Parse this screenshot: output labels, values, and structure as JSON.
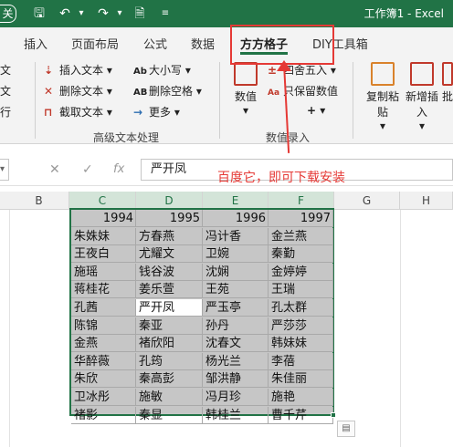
{
  "titlebar": {
    "left_chip": "关",
    "title": "工作簿1 - Excel"
  },
  "tabs": [
    "插入",
    "页面布局",
    "公式",
    "数据",
    "方方格子",
    "DIY工具箱"
  ],
  "active_tab": "方方格子",
  "ribbon": {
    "left_col": [
      "文",
      "文",
      "行"
    ],
    "text_group": {
      "items": [
        "插入文本",
        "删除文本",
        "截取文本",
        "大小写",
        "删除空格",
        "更多"
      ],
      "label": "高级文本处理"
    },
    "numeric_group": {
      "big_button": "数值",
      "items": [
        "四舍五入",
        "只保留数值"
      ],
      "plus": "+",
      "label": "数值录入"
    },
    "right_buttons": [
      "复制粘贴",
      "新增插入",
      "批"
    ]
  },
  "callout": {
    "text": "百度它，即可下载安装"
  },
  "formula_bar": {
    "fx": "fx",
    "value": "严开凤"
  },
  "columns": [
    "B",
    "C",
    "D",
    "E",
    "F",
    "G",
    "H"
  ],
  "table": {
    "headers": [
      "1994",
      "1995",
      "1996",
      "1997"
    ],
    "rows": [
      [
        "朱姝妹",
        "方春燕",
        "冯计香",
        "金兰燕"
      ],
      [
        "王夜白",
        "尤耀文",
        "卫婉",
        "秦勤"
      ],
      [
        "施瑶",
        "钱谷波",
        "沈娴",
        "金婷婷"
      ],
      [
        "蒋桂花",
        "姜乐萱",
        "王苑",
        "王瑞"
      ],
      [
        "孔茜",
        "严开凤",
        "严玉亭",
        "孔太群"
      ],
      [
        "陈锦",
        "秦亚",
        "孙丹",
        "严莎莎"
      ],
      [
        "金燕",
        "褚欣阳",
        "沈春文",
        "韩妹妹"
      ],
      [
        "华醉薇",
        "孔筠",
        "杨光兰",
        "李蓓"
      ],
      [
        "朱欣",
        "秦高彭",
        "邹洪静",
        "朱佳丽"
      ],
      [
        "卫冰彤",
        "施敏",
        "冯月珍",
        "施艳"
      ],
      [
        "褚影",
        "秦显",
        "韩桂兰",
        "曹千芹"
      ]
    ]
  },
  "colors": {
    "excel_green": "#217346",
    "callout_red": "#e53935",
    "selection_gray": "#c6c6c6"
  }
}
